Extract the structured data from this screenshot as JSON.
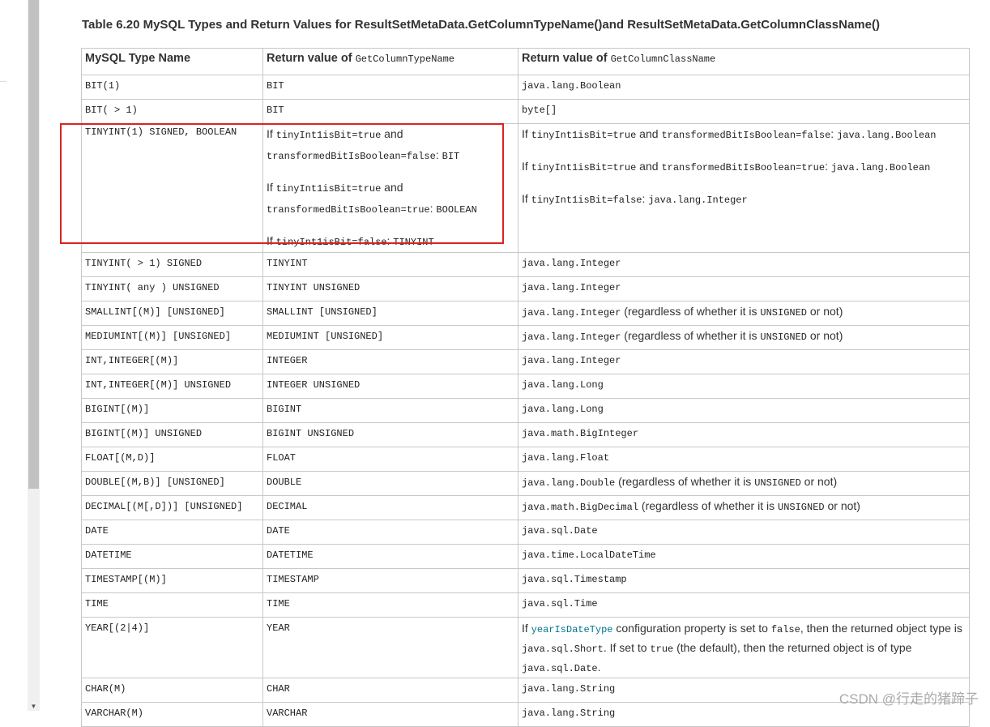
{
  "caption": "Table 6.20 MySQL Types and Return Values for ResultSetMetaData.GetColumnTypeName()and ResultSetMetaData.GetColumnClassName()",
  "headers": {
    "c1": "MySQL Type Name",
    "c2_prefix": "Return value of ",
    "c2_code": "GetColumnTypeName",
    "c3_prefix": "Return value of ",
    "c3_code": "GetColumnClassName"
  },
  "rows": [
    {
      "type": "BIT(1)",
      "ret": "BIT",
      "cls": "java.lang.Boolean"
    },
    {
      "type": "BIT( > 1)",
      "ret": "BIT",
      "cls": "byte[]"
    },
    {
      "type": "TINYINT( > 1) SIGNED",
      "ret": "TINYINT",
      "cls": "java.lang.Integer"
    },
    {
      "type": "TINYINT( any ) UNSIGNED",
      "ret": "TINYINT UNSIGNED",
      "cls": "java.lang.Integer"
    },
    {
      "type": "SMALLINT[(M)] [UNSIGNED]",
      "ret": "SMALLINT [UNSIGNED]",
      "cls": "java.lang.Integer",
      "note_pre": " (regardless of whether it is ",
      "note_code": "UNSIGNED",
      "note_post": " or not)"
    },
    {
      "type": "MEDIUMINT[(M)] [UNSIGNED]",
      "ret": "MEDIUMINT [UNSIGNED]",
      "cls": "java.lang.Integer",
      "note_pre": " (regardless of whether it is ",
      "note_code": "UNSIGNED",
      "note_post": " or not)"
    },
    {
      "type": "INT,INTEGER[(M)]",
      "ret": "INTEGER",
      "cls": "java.lang.Integer"
    },
    {
      "type": "INT,INTEGER[(M)] UNSIGNED",
      "ret": "INTEGER UNSIGNED",
      "cls": "java.lang.Long"
    },
    {
      "type": "BIGINT[(M)]",
      "ret": "BIGINT",
      "cls": "java.lang.Long"
    },
    {
      "type": "BIGINT[(M)] UNSIGNED",
      "ret": "BIGINT UNSIGNED",
      "cls": "java.math.BigInteger"
    },
    {
      "type": "FLOAT[(M,D)]",
      "ret": "FLOAT",
      "cls": "java.lang.Float"
    },
    {
      "type": "DOUBLE[(M,B)] [UNSIGNED]",
      "ret": "DOUBLE",
      "cls": "java.lang.Double",
      "note_pre": " (regardless of whether it is ",
      "note_code": "UNSIGNED",
      "note_post": " or not)"
    },
    {
      "type": "DECIMAL[(M[,D])] [UNSIGNED]",
      "ret": "DECIMAL",
      "cls": "java.math.BigDecimal",
      "note_pre": " (regardless of whether it is ",
      "note_code": "UNSIGNED",
      "note_post": " or not)"
    },
    {
      "type": "DATE",
      "ret": "DATE",
      "cls": "java.sql.Date"
    },
    {
      "type": "DATETIME",
      "ret": "DATETIME",
      "cls": "java.time.LocalDateTime"
    },
    {
      "type": "TIMESTAMP[(M)]",
      "ret": "TIMESTAMP",
      "cls": "java.sql.Timestamp"
    },
    {
      "type": "TIME",
      "ret": "TIME",
      "cls": "java.sql.Time"
    }
  ],
  "tinyint1": {
    "type": "TINYINT(1) SIGNED, BOOLEAN",
    "ret": [
      {
        "if": "If ",
        "a": "tinyInt1isBit=true",
        "and": " and ",
        "b": "transformedBitIsBoolean=false",
        "colon": ": ",
        "v": "BIT"
      },
      {
        "if": "If ",
        "a": "tinyInt1isBit=true",
        "and": " and ",
        "b": "transformedBitIsBoolean=true",
        "colon": ": ",
        "v": "BOOLEAN"
      },
      {
        "if": "If ",
        "a": "tinyInt1isBit=false",
        "colon": ": ",
        "v": "TINYINT"
      }
    ],
    "cls": [
      {
        "if": "If ",
        "a": "tinyInt1isBit=true",
        "and": " and ",
        "b": "transformedBitIsBoolean=false",
        "colon": ": ",
        "v": "java.lang.Boolean"
      },
      {
        "if": "If ",
        "a": "tinyInt1isBit=true",
        "and": " and ",
        "b": "transformedBitIsBoolean=true",
        "colon": ": ",
        "v": "java.lang.Boolean"
      },
      {
        "if": "If ",
        "a": "tinyInt1isBit=false",
        "colon": ": ",
        "v": "java.lang.Integer"
      }
    ]
  },
  "year": {
    "type": "YEAR[(2|4)]",
    "ret": "YEAR",
    "p1": "If ",
    "link": "yearIsDateType",
    "p2": " configuration property is set to ",
    "c1": "false",
    "p3": ", then the returned object type is ",
    "c2": "java.sql.Short",
    "p4": ". If set to ",
    "c3": "true",
    "p5": " (the default), then the returned object is of type ",
    "c4": "java.sql.Date",
    "p6": "."
  },
  "tail_rows": [
    {
      "type": "CHAR(M)",
      "ret": "CHAR",
      "cls": "java.lang.String"
    },
    {
      "type": "VARCHAR(M)",
      "ret": "VARCHAR",
      "cls": "java.lang.String"
    }
  ],
  "watermark": "CSDN @行走的猪蹄子"
}
